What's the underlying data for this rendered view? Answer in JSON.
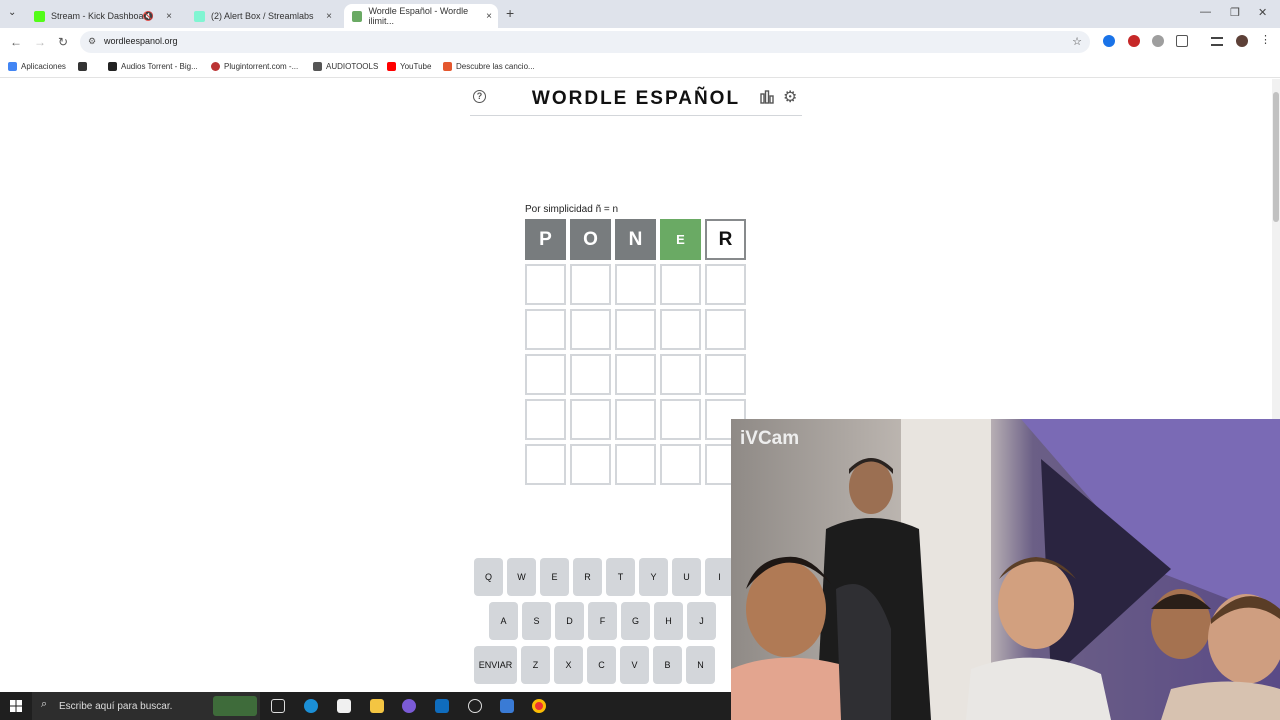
{
  "browser": {
    "tabs": [
      {
        "label": "Stream - Kick Dashboard",
        "favicon_color": "#53fc18"
      },
      {
        "label": "(2) Alert Box / Streamlabs",
        "favicon_color": "#80f5d2"
      },
      {
        "label": "Wordle Español - Wordle ilimit...",
        "favicon_color": "#6aaa64"
      }
    ],
    "url": "wordleespanol.org",
    "bookmarks": [
      {
        "label": "Aplicaciones",
        "color": "#4285f4"
      },
      {
        "label": "Audios Torrent - Big...",
        "color": "#222222"
      },
      {
        "label": "Plugintorrent.com -...",
        "color": "#b33"
      },
      {
        "label": "AUDIOTOOLS",
        "color": "#555555"
      },
      {
        "label": "YouTube",
        "color": "#ff0000"
      },
      {
        "label": "Descubre las cancio...",
        "color": "#e4572e"
      }
    ]
  },
  "game": {
    "title": "WORDLE ESPAÑOL",
    "note": "Por simplicidad ñ = n",
    "current_row": [
      {
        "letter": "P",
        "state": "absent"
      },
      {
        "letter": "O",
        "state": "absent"
      },
      {
        "letter": "N",
        "state": "absent"
      },
      {
        "letter": "E",
        "state": "correct"
      },
      {
        "letter": "R",
        "state": "tbd"
      }
    ],
    "keyboard": {
      "row1": [
        "Q",
        "W",
        "E",
        "R",
        "T",
        "Y",
        "U",
        "I"
      ],
      "row2": [
        "A",
        "S",
        "D",
        "F",
        "G",
        "H",
        "J"
      ],
      "row3": [
        "ENVIAR",
        "Z",
        "X",
        "C",
        "V",
        "B",
        "N"
      ]
    },
    "colors": {
      "correct": "#6aaa64",
      "absent": "#787c7e",
      "key": "#d3d6da"
    }
  },
  "webcam": {
    "label": "iVCam"
  },
  "taskbar": {
    "search_placeholder": "Escribe aquí para buscar."
  }
}
